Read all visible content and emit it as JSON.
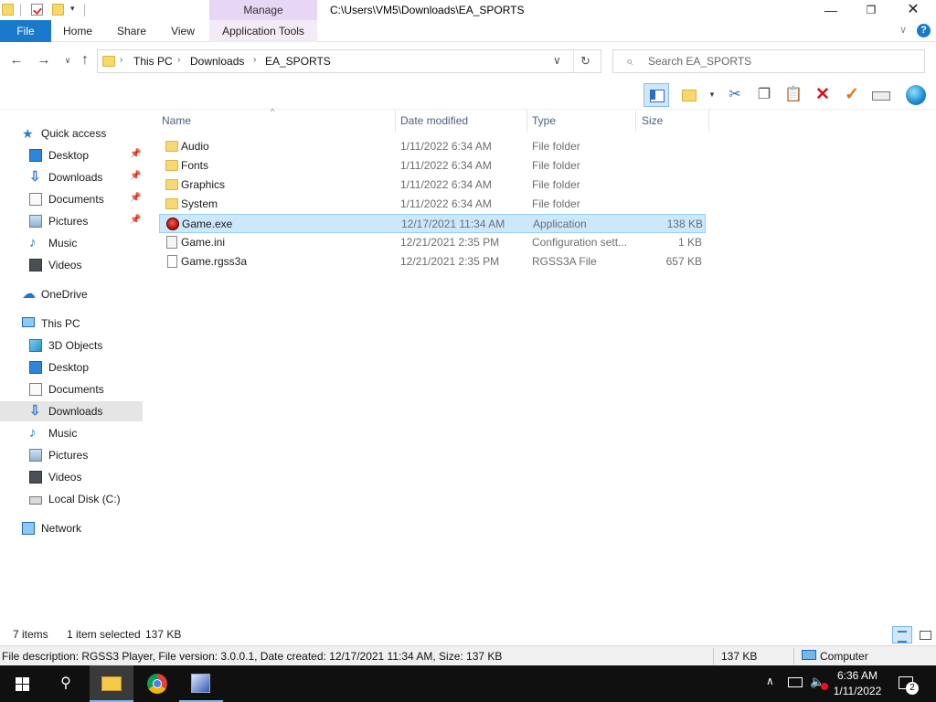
{
  "titlebar": {
    "manage_label": "Manage",
    "path": "C:\\Users\\VM5\\Downloads\\EA_SPORTS",
    "minimize": "—",
    "maximize": "❐",
    "close": "✕"
  },
  "ribbon": {
    "tabs": {
      "file": "File",
      "home": "Home",
      "share": "Share",
      "view": "View",
      "app_tools": "Application Tools"
    },
    "expand_glyph": "∨",
    "help_glyph": "?"
  },
  "address": {
    "back_glyph": "←",
    "forward_glyph": "→",
    "recent_glyph": "∨",
    "up_glyph": "↑",
    "breadcrumb": [
      "This PC",
      "Downloads",
      "EA_SPORTS"
    ],
    "separator": "›",
    "dropdown_glyph": "∨",
    "refresh_glyph": "↻"
  },
  "search": {
    "placeholder": "Search EA_SPORTS",
    "icon_glyph": "⌕"
  },
  "toolbar": {
    "cut_glyph": "✂",
    "copy_glyph": "❐",
    "paste_glyph": "📋",
    "delete_glyph": "✕",
    "rename_glyph": "✓",
    "dropdown_glyph": "▼"
  },
  "nav": {
    "quick_access": {
      "label": "Quick access",
      "items": [
        {
          "label": "Desktop",
          "pinned": true
        },
        {
          "label": "Downloads",
          "pinned": true
        },
        {
          "label": "Documents",
          "pinned": true
        },
        {
          "label": "Pictures",
          "pinned": true
        },
        {
          "label": "Music",
          "pinned": false
        },
        {
          "label": "Videos",
          "pinned": false
        }
      ]
    },
    "onedrive": "OneDrive",
    "this_pc": {
      "label": "This PC",
      "items": [
        "3D Objects",
        "Desktop",
        "Documents",
        "Downloads",
        "Music",
        "Pictures",
        "Videos",
        "Local Disk (C:)"
      ]
    },
    "network": "Network",
    "pin_glyph": "📌",
    "selected": "Downloads"
  },
  "columns": {
    "name": "Name",
    "date": "Date modified",
    "type": "Type",
    "size": "Size",
    "sort_glyph": "^"
  },
  "files": [
    {
      "name": "Audio",
      "date": "1/11/2022 6:34 AM",
      "type": "File folder",
      "size": "",
      "icon": "folder-icon",
      "selected": false
    },
    {
      "name": "Fonts",
      "date": "1/11/2022 6:34 AM",
      "type": "File folder",
      "size": "",
      "icon": "folder-icon",
      "selected": false
    },
    {
      "name": "Graphics",
      "date": "1/11/2022 6:34 AM",
      "type": "File folder",
      "size": "",
      "icon": "folder-icon",
      "selected": false
    },
    {
      "name": "System",
      "date": "1/11/2022 6:34 AM",
      "type": "File folder",
      "size": "",
      "icon": "folder-icon",
      "selected": false
    },
    {
      "name": "Game.exe",
      "date": "12/17/2021 11:34 AM",
      "type": "Application",
      "size": "138 KB",
      "icon": "application-icon",
      "selected": true
    },
    {
      "name": "Game.ini",
      "date": "12/21/2021 2:35 PM",
      "type": "Configuration sett...",
      "size": "1 KB",
      "icon": "config-file-icon",
      "selected": false
    },
    {
      "name": "Game.rgss3a",
      "date": "12/21/2021 2:35 PM",
      "type": "RGSS3A File",
      "size": "657 KB",
      "icon": "file-icon",
      "selected": false
    }
  ],
  "status": {
    "count": "7 items",
    "selected": "1 item selected",
    "size": "137 KB"
  },
  "details": {
    "description": "File description: RGSS3 Player, File version: 3.0.0.1, Date created: 12/17/2021 11:34 AM, Size: 137 KB",
    "size": "137 KB",
    "location": "Computer"
  },
  "taskbar": {
    "search_glyph": "⚲",
    "tray_chevron": "∧",
    "volume_glyph": "🔈",
    "time": "6:36 AM",
    "date": "1/11/2022",
    "notification_count": "2"
  }
}
